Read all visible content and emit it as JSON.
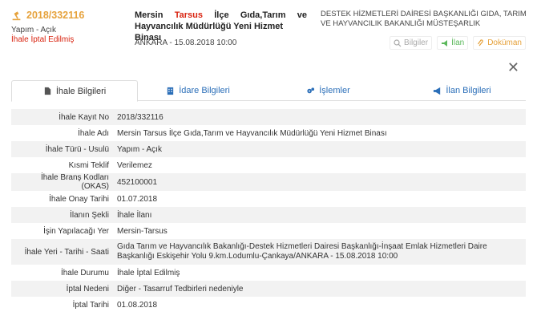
{
  "header": {
    "kayit_no": "2018/332116",
    "tur_usul": "Yapım - Açık",
    "durum": "İhale İptal Edilmiş",
    "title_city": "Mersin",
    "title_district": "Tarsus",
    "title_w1": "İlçe",
    "title_w2": "Gıda,Tarım",
    "title_w3": "ve",
    "title_line2": "Hayvancılık Müdürlüğü Yeni Hizmet Binası",
    "place_date": "ANKARA - 15.08.2018 10:00",
    "idare": "DESTEK HİZMETLERİ DAİRESİ BAŞKANLIĞI GIDA, TARIM VE HAYVANCILIK BAKANLIĞI MÜSTEŞARLIK",
    "actions": {
      "bilgiler": "Bilgiler",
      "ilan": "İlan",
      "dokuman": "Doküman"
    },
    "close": "✕"
  },
  "tabs": [
    {
      "label": "İhale Bilgileri",
      "icon": "document-icon"
    },
    {
      "label": "İdare Bilgileri",
      "icon": "building-icon"
    },
    {
      "label": "İşlemler",
      "icon": "gears-icon"
    },
    {
      "label": "İlan Bilgileri",
      "icon": "megaphone-icon"
    }
  ],
  "rows": [
    {
      "label": "İhale Kayıt No",
      "value": "2018/332116"
    },
    {
      "label": "İhale Adı",
      "value": "Mersin Tarsus İlçe Gıda,Tarım ve Hayvancılık Müdürlüğü Yeni Hizmet Binası"
    },
    {
      "label": "İhale Türü - Usulü",
      "value": "Yapım - Açık"
    },
    {
      "label": "Kısmi Teklif",
      "value": "Verilemez"
    },
    {
      "label": "İhale Branş Kodları (OKAS)",
      "value": "452100001"
    },
    {
      "label": "İhale Onay Tarihi",
      "value": "01.07.2018"
    },
    {
      "label": "İlanın Şekli",
      "value": "İhale İlanı"
    },
    {
      "label": "İşin Yapılacağı Yer",
      "value": "Mersin-Tarsus"
    },
    {
      "label": "İhale Yeri - Tarihi - Saati",
      "value": "Gıda Tarım ve Hayvancılık Bakanlığı-Destek Hizmetleri Dairesi Başkanlığı-İnşaat Emlak Hizmetleri Daire Başkanlığı Eskişehir Yolu 9.km.Lodumlu-Çankaya/ANKARA - 15.08.2018 10:00"
    },
    {
      "label": "İhale Durumu",
      "value": "İhale İptal Edilmiş"
    },
    {
      "label": "İptal Nedeni",
      "value": "Diğer - Tasarruf Tedbirleri nedeniyle"
    },
    {
      "label": "İptal Tarihi",
      "value": "01.08.2018"
    }
  ]
}
